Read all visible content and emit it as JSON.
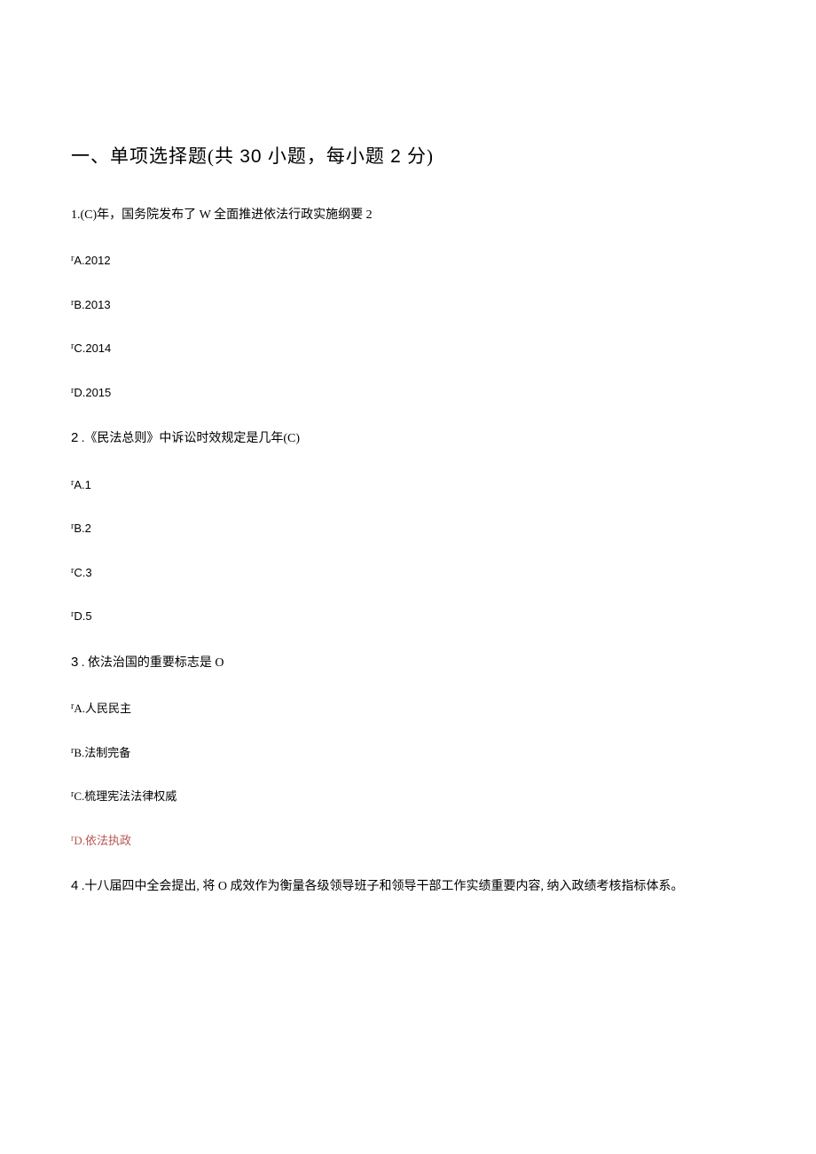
{
  "section": {
    "heading_prefix": "一、单项选择题(共 ",
    "count": "30",
    "heading_mid": " 小题，每小题 ",
    "points": "2",
    "heading_suffix": " 分)"
  },
  "q1": {
    "text": "1.(C)年，国务院发布了 W 全面推进依法行政实施纲要 2",
    "a": "A.2012",
    "b": "B.2013",
    "c": "C.2014",
    "d": "D.2015"
  },
  "q2": {
    "num": "2",
    "text": " .《民法总则》中诉讼时效规定是几年(C)",
    "a": "A.1",
    "b": "B.2",
    "c": "C.3",
    "d": "D.5"
  },
  "q3": {
    "num": "3",
    "text": " . 依法治国的重要标志是 O",
    "a": "A.人民民主",
    "b": "B.法制完备",
    "c": "C.梳理宪法法律权威",
    "d": "D.依法执政"
  },
  "q4": {
    "num": "4",
    "text": " .十八届四中全会提出, 将 O 成效作为衡量各级领导班子和领导干部工作实绩重要内容, 纳入政绩考核指标体系。"
  },
  "prefix_r": "r"
}
